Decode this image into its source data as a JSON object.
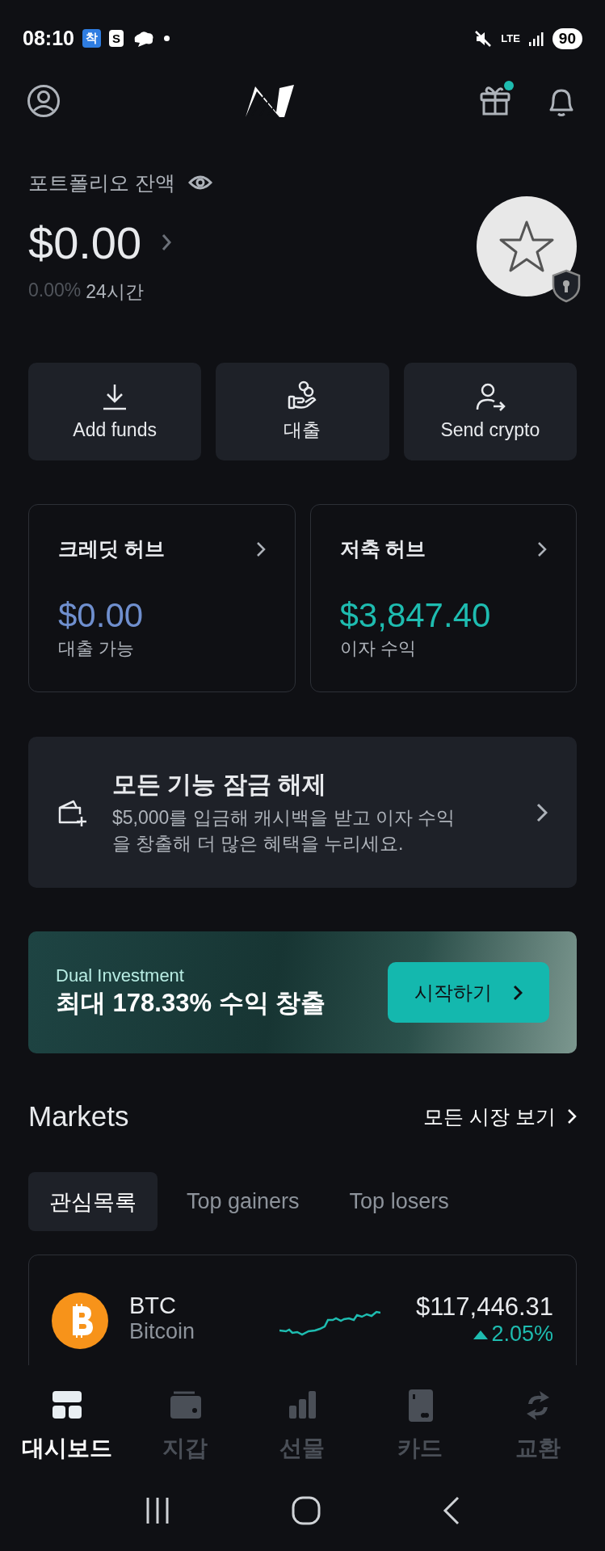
{
  "status_bar": {
    "time": "08:10",
    "notifications": [
      "착",
      "S"
    ],
    "network": "LTE",
    "battery": "90"
  },
  "header": {
    "gift_has_notification": true
  },
  "portfolio": {
    "label": "포트폴리오 잔액",
    "balance": "$0.00",
    "change": "0.00%",
    "period": "24시간"
  },
  "actions": [
    {
      "label": "Add funds",
      "kind": "deposit"
    },
    {
      "label": "대출",
      "kind": "loan"
    },
    {
      "label": "Send crypto",
      "kind": "send"
    }
  ],
  "hubs": [
    {
      "title": "크레딧 허브",
      "amount": "$0.00",
      "caption": "대출 가능",
      "color": "#6f8fce"
    },
    {
      "title": "저축 허브",
      "amount": "$3,847.40",
      "caption": "이자 수익",
      "color": "#1ebcb0"
    }
  ],
  "unlock": {
    "title": "모든 기능 잠금 해제",
    "text": "$5,000를 입금해 캐시백을 받고 이자 수익을 창출해 더 많은 혜택을 누리세요."
  },
  "promo": {
    "label": "Dual Investment",
    "headline": "최대 178.33% 수익 창출",
    "button": "시작하기"
  },
  "markets": {
    "title": "Markets",
    "link": "모든 시장 보기",
    "tabs": [
      {
        "label": "관심목록",
        "selected": true
      },
      {
        "label": "Top gainers",
        "selected": false
      },
      {
        "label": "Top losers",
        "selected": false
      }
    ],
    "rows": [
      {
        "symbol": "BTC",
        "name": "Bitcoin",
        "price": "$117,446.31",
        "change": "2.05%",
        "rising": true
      }
    ]
  },
  "nav": [
    {
      "label": "대시보드",
      "kind": "dashboard",
      "selected": true
    },
    {
      "label": "지갑",
      "kind": "wallet",
      "selected": false
    },
    {
      "label": "선물",
      "kind": "futures",
      "selected": false
    },
    {
      "label": "카드",
      "kind": "card",
      "selected": false
    },
    {
      "label": "교환",
      "kind": "exchange",
      "selected": false
    }
  ]
}
